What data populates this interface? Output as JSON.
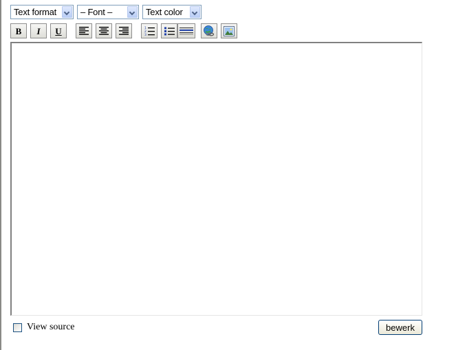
{
  "toolbar": {
    "selects": [
      {
        "name": "text-format",
        "value": "Text format"
      },
      {
        "name": "font",
        "value": "– Font –"
      },
      {
        "name": "text-color",
        "value": "Text color"
      }
    ],
    "buttons": {
      "bold": "B",
      "italic": "I",
      "underline": "U",
      "align_left_icon": "align-left-icon",
      "align_center_icon": "align-center-icon",
      "align_right_icon": "align-right-icon",
      "ordered_list_icon": "ordered-list-icon",
      "unordered_list_icon": "unordered-list-icon",
      "horizontal_rule_icon": "horizontal-rule-icon",
      "link_icon": "globe-link-icon",
      "image_icon": "image-icon"
    }
  },
  "editor": {
    "content": ""
  },
  "footer": {
    "view_source_label": "View source",
    "view_source_checked": false,
    "submit_label": "bewerk"
  },
  "colors": {
    "select_border": "#7f9db9",
    "arrow_bg": "#c3d3fd",
    "button_border": "#003c74"
  }
}
